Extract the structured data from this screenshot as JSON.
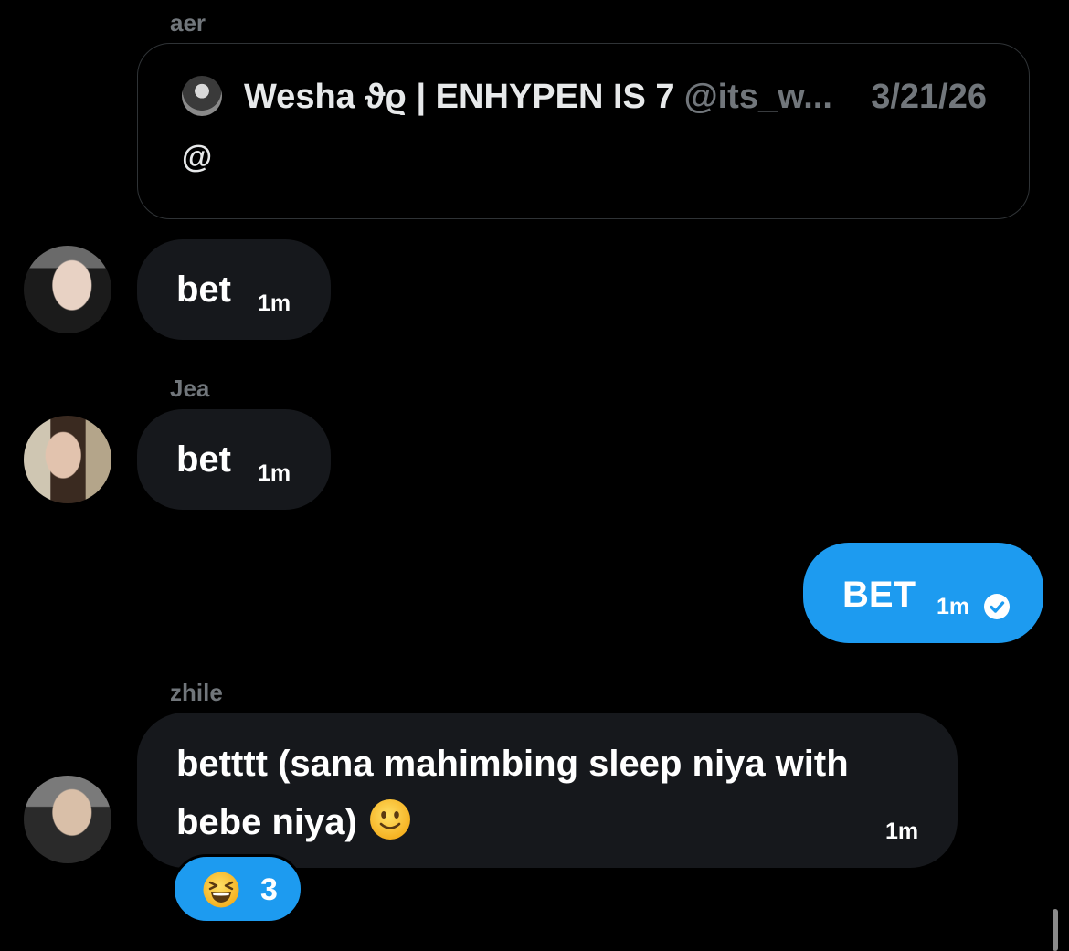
{
  "messages": [
    {
      "sender": "aer",
      "quote": {
        "display_name": "Wesha ϑϱ | ENHYPEN IS 7",
        "handle": "@its_w...",
        "date": "3/21/26",
        "body": "@"
      },
      "text": "bet",
      "time": "1m"
    },
    {
      "sender": "Jea",
      "text": "bet",
      "time": "1m"
    },
    {
      "sender": "me",
      "text": "BET",
      "time": "1m",
      "status_icon": "check-circle-icon"
    },
    {
      "sender": "zhile",
      "text_line1": "betttt (sana mahimbing sleep niya with",
      "text_line2": "bebe niya)",
      "emoji": "slightly-smiling-face",
      "time": "1m",
      "reaction": {
        "emoji": "grinning-squinting-face",
        "count": "3"
      }
    }
  ],
  "colors": {
    "background": "#000000",
    "incoming_bubble": "#16181c",
    "outgoing_bubble": "#1d9bf0",
    "muted_text": "#71767b"
  }
}
